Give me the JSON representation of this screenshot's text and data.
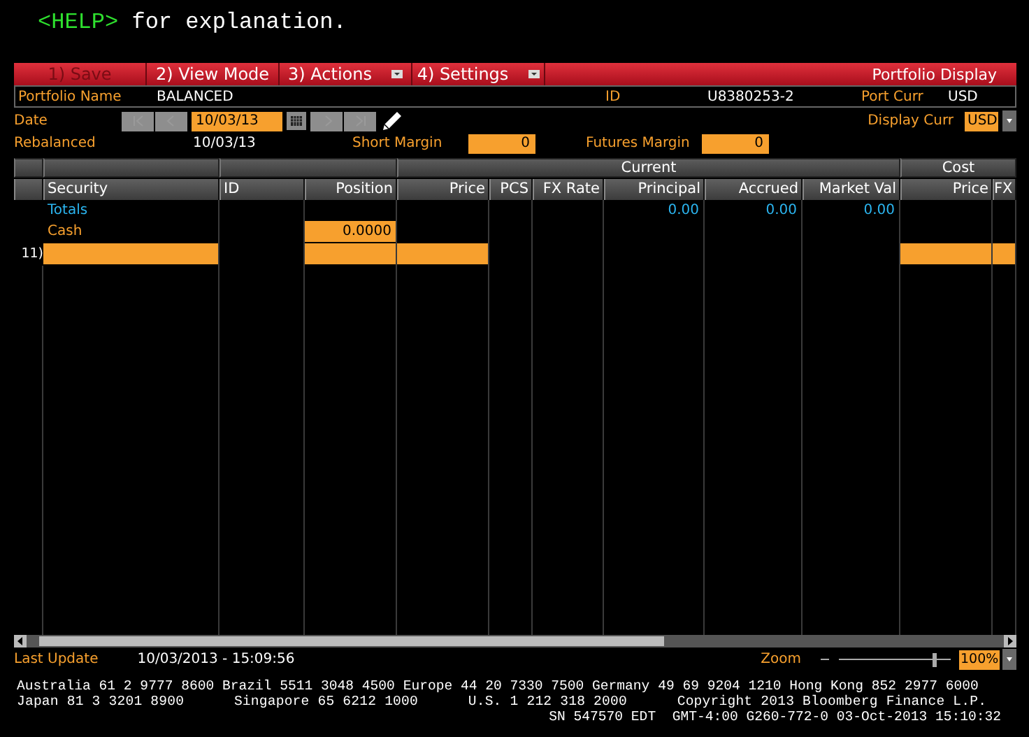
{
  "help": {
    "key": "<HELP>",
    "text": "for explanation."
  },
  "menu": {
    "items": [
      {
        "label": "1) Save",
        "disabled": true,
        "dropdown": false
      },
      {
        "label": "2) View Mode",
        "disabled": false,
        "dropdown": false
      },
      {
        "label": "3) Actions",
        "disabled": false,
        "dropdown": true
      },
      {
        "label": "4) Settings",
        "disabled": false,
        "dropdown": true
      }
    ],
    "title": "Portfolio Display"
  },
  "portfolio": {
    "name_label": "Portfolio Name",
    "name": "BALANCED",
    "id_label": "ID",
    "id": "U8380253-2",
    "port_curr_label": "Port Curr",
    "port_curr": "USD"
  },
  "date": {
    "label": "Date",
    "value": "10/03/13"
  },
  "display_curr": {
    "label": "Display Curr",
    "value": "USD"
  },
  "rebalanced": {
    "label": "Rebalanced",
    "value": "10/03/13"
  },
  "short_margin": {
    "label": "Short Margin",
    "value": "0"
  },
  "futures_margin": {
    "label": "Futures Margin",
    "value": "0"
  },
  "table": {
    "column_groups": [
      {
        "label": "Current"
      },
      {
        "label": "Cost"
      }
    ],
    "columns": [
      "Security",
      "ID",
      "Position",
      "Price",
      "PCS",
      "FX Rate",
      "Principal",
      "Accrued",
      "Market Val",
      "Price",
      "FX"
    ],
    "rows": [
      {
        "kind": "totals",
        "cells": [
          {
            "kind": "text",
            "text": "Totals"
          },
          {
            "kind": "blank"
          },
          {
            "kind": "blank"
          },
          {
            "kind": "blank"
          },
          {
            "kind": "blank"
          },
          {
            "kind": "blank"
          },
          {
            "kind": "text",
            "text": "0.00"
          },
          {
            "kind": "text",
            "text": "0.00"
          },
          {
            "kind": "text",
            "text": "0.00"
          },
          {
            "kind": "blank"
          },
          {
            "kind": "blank"
          }
        ]
      },
      {
        "kind": "cash",
        "cells": [
          {
            "kind": "text",
            "text": "Cash"
          },
          {
            "kind": "blank"
          },
          {
            "kind": "field",
            "text": "0.0000"
          },
          {
            "kind": "blank"
          },
          {
            "kind": "blank"
          },
          {
            "kind": "blank"
          },
          {
            "kind": "blank"
          },
          {
            "kind": "blank"
          },
          {
            "kind": "blank"
          },
          {
            "kind": "blank"
          },
          {
            "kind": "blank"
          }
        ]
      },
      {
        "kind": "entry",
        "number": "11)",
        "cells": [
          {
            "kind": "field"
          },
          {
            "kind": "blank"
          },
          {
            "kind": "field"
          },
          {
            "kind": "field"
          },
          {
            "kind": "blank"
          },
          {
            "kind": "blank"
          },
          {
            "kind": "blank"
          },
          {
            "kind": "blank"
          },
          {
            "kind": "blank"
          },
          {
            "kind": "field"
          },
          {
            "kind": "field"
          }
        ]
      }
    ]
  },
  "status": {
    "last_update_label": "Last Update",
    "last_update": "10/03/2013 - 15:09:56",
    "zoom_label": "Zoom",
    "zoom": {
      "level": 0.87
    },
    "zoom_value": "100%"
  },
  "footer": [
    "Australia 61 2 9777 8600 Brazil 5511 3048 4500 Europe 44 20 7330 7500 Germany 49 69 9204 1210 Hong Kong 852 2977 6000",
    "Japan 81 3 3201 8900      Singapore 65 6212 1000      U.S. 1 212 318 2000      Copyright 2013 Bloomberg Finance L.P.",
    "SN 547570 EDT  GMT-4:00 G260-772-0 03-Oct-2013 15:10:32"
  ]
}
